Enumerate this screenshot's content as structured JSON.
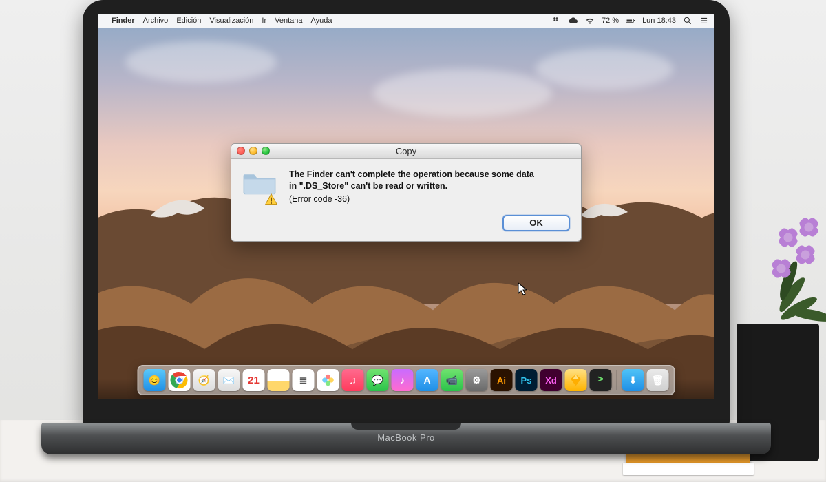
{
  "menubar": {
    "app": "Finder",
    "items": [
      "Archivo",
      "Edición",
      "Visualización",
      "Ir",
      "Ventana",
      "Ayuda"
    ],
    "battery_text": "72 %",
    "clock": "Lun 18:43"
  },
  "dialog": {
    "title": "Copy",
    "message_line1": "The Finder can't complete the operation because some data",
    "message_line2": "in \".DS_Store\" can't be read or written.",
    "error_code": "(Error code -36)",
    "ok_label": "OK"
  },
  "dock": {
    "items": [
      {
        "name": "finder",
        "label": "",
        "bg": "linear-gradient(#5ac8fa,#1f8fe6)",
        "glyph": "😊"
      },
      {
        "name": "chrome",
        "label": "",
        "bg": "#fff",
        "glyph": "◉"
      },
      {
        "name": "safari",
        "label": "",
        "bg": "linear-gradient(#f7f7f7,#dcdcdc)",
        "glyph": "🧭"
      },
      {
        "name": "mail",
        "label": "",
        "bg": "linear-gradient(#f7f7f7,#dcdcdc)",
        "glyph": "✉️"
      },
      {
        "name": "calendar",
        "label": "21",
        "bg": "#fff",
        "glyph": "21"
      },
      {
        "name": "notes",
        "label": "",
        "bg": "linear-gradient(#fff 55%,#ffd76b 55%)",
        "glyph": ""
      },
      {
        "name": "reminders",
        "label": "",
        "bg": "#fff",
        "glyph": "≣"
      },
      {
        "name": "photos",
        "label": "",
        "bg": "#fff",
        "glyph": "✿"
      },
      {
        "name": "music",
        "label": "",
        "bg": "linear-gradient(#ff6a8e,#ff3b5c)",
        "glyph": "♫"
      },
      {
        "name": "messages",
        "label": "",
        "bg": "linear-gradient(#6fe36f,#2bc24a)",
        "glyph": "💬"
      },
      {
        "name": "itunes",
        "label": "",
        "bg": "linear-gradient(#c96bff,#ff6bd0)",
        "glyph": "♪"
      },
      {
        "name": "appstore",
        "label": "",
        "bg": "linear-gradient(#53b6ff,#1f8fe6)",
        "glyph": "A"
      },
      {
        "name": "facetime",
        "label": "",
        "bg": "linear-gradient(#6fe36f,#2bc24a)",
        "glyph": "📹"
      },
      {
        "name": "preferences",
        "label": "",
        "bg": "linear-gradient(#9a9a9a,#6a6a6a)",
        "glyph": "⚙"
      },
      {
        "name": "illustrator",
        "label": "Ai",
        "bg": "#2a1200",
        "glyph": "Ai"
      },
      {
        "name": "photoshop",
        "label": "Ps",
        "bg": "#001d33",
        "glyph": "Ps"
      },
      {
        "name": "xd",
        "label": "Xd",
        "bg": "#40002f",
        "glyph": "Xd"
      },
      {
        "name": "sketch",
        "label": "",
        "bg": "linear-gradient(#ffe082,#ffb300)",
        "glyph": "◆"
      },
      {
        "name": "terminal",
        "label": "",
        "bg": "#222",
        "glyph": ">"
      }
    ],
    "right_items": [
      {
        "name": "downloads",
        "bg": "linear-gradient(#4fc3f7,#1f8fe6)",
        "glyph": "⬇"
      },
      {
        "name": "trash",
        "bg": "linear-gradient(#eaeaea,#cfcfcf)",
        "glyph": "🗑"
      }
    ]
  },
  "laptop": {
    "brand": "MacBook Pro"
  }
}
